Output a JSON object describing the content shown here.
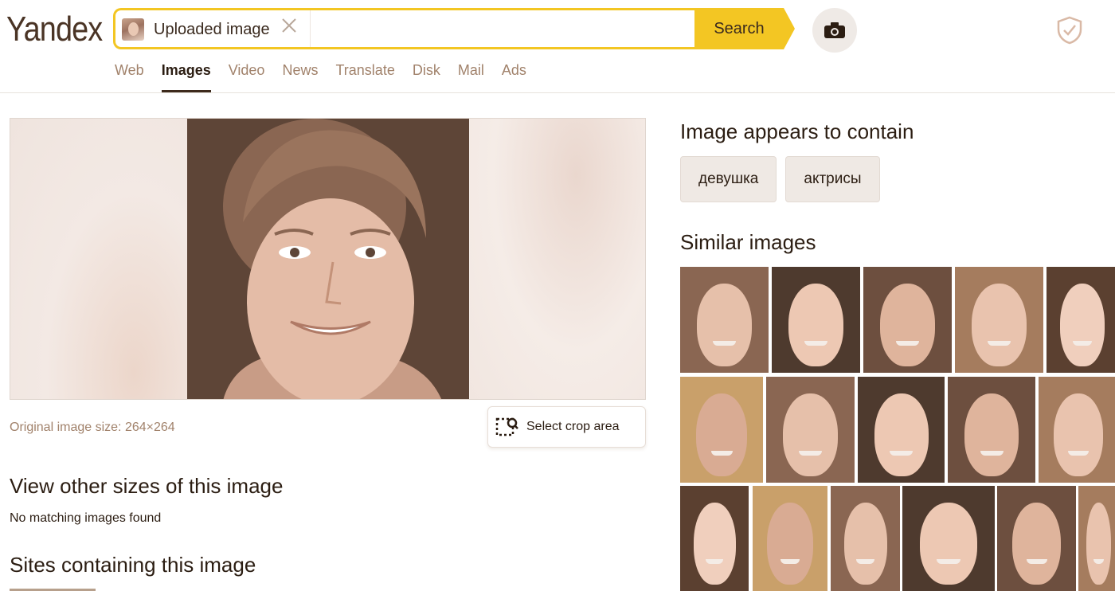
{
  "header": {
    "logo": "Yandex",
    "search_chip_label": "Uploaded image",
    "search_button": "Search"
  },
  "nav": [
    {
      "label": "Web",
      "active": false
    },
    {
      "label": "Images",
      "active": true
    },
    {
      "label": "Video",
      "active": false
    },
    {
      "label": "News",
      "active": false
    },
    {
      "label": "Translate",
      "active": false
    },
    {
      "label": "Disk",
      "active": false
    },
    {
      "label": "Mail",
      "active": false
    },
    {
      "label": "Ads",
      "active": false
    }
  ],
  "main": {
    "original_size": "Original image size: 264×264",
    "crop_button": "Select crop area",
    "other_sizes_heading": "View other sizes of this image",
    "no_matching": "No matching images found",
    "sites_heading": "Sites containing this image"
  },
  "sidebar": {
    "contains_heading": "Image appears to contain",
    "tags": [
      "девушка",
      "актрисы"
    ],
    "similar_heading": "Similar images"
  },
  "colors": {
    "accent_yellow": "#f3c623",
    "nav_inactive": "#a1826b",
    "text_dark": "#2b1d12"
  },
  "icons": {
    "camera": "camera-icon",
    "shield": "shield-check-icon",
    "crop": "crop-icon",
    "close": "close-icon"
  }
}
